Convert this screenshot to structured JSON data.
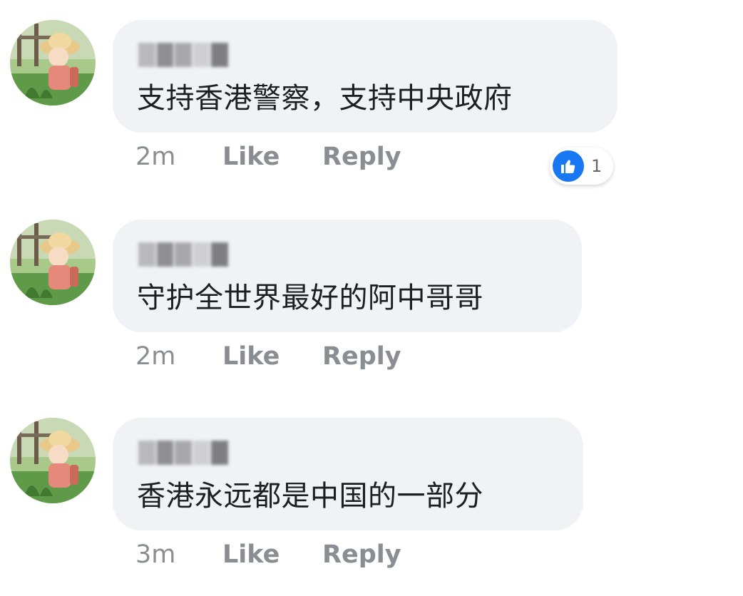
{
  "comments": [
    {
      "time": "2m",
      "like_label": "Like",
      "reply_label": "Reply",
      "text": "支持香港警察，支持中央政府",
      "reaction_count": "1"
    },
    {
      "time": "2m",
      "like_label": "Like",
      "reply_label": "Reply",
      "text": "守护全世界最好的阿中哥哥"
    },
    {
      "time": "3m",
      "like_label": "Like",
      "reply_label": "Reply",
      "text": "香港永远都是中国的一部分"
    }
  ],
  "icons": {
    "reaction": "thumbs-up-icon",
    "avatar": "cartoon-girl-with-straw-hat"
  },
  "colors": {
    "bubble": "#f0f2f5",
    "text": "#1c1e21",
    "meta": "#8a8d91",
    "like_blue": "#1877f2"
  }
}
